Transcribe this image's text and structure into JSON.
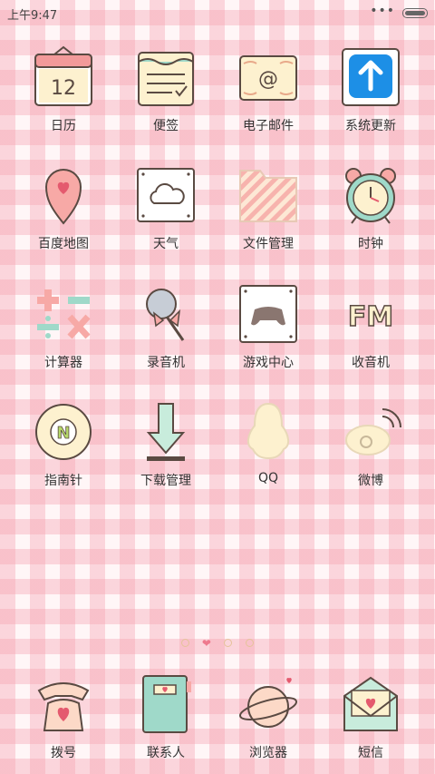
{
  "status_bar": {
    "time": "上午9:47",
    "signal_dots": "•••"
  },
  "apps": [
    {
      "label": "日历",
      "icon": "calendar-icon",
      "date_text": "12"
    },
    {
      "label": "便签",
      "icon": "notes-icon"
    },
    {
      "label": "电子邮件",
      "icon": "email-icon",
      "at_symbol": "@"
    },
    {
      "label": "系统更新",
      "icon": "update-arrow-icon"
    },
    {
      "label": "百度地图",
      "icon": "map-pin-icon"
    },
    {
      "label": "天气",
      "icon": "cloud-icon"
    },
    {
      "label": "文件管理",
      "icon": "folder-icon"
    },
    {
      "label": "时钟",
      "icon": "alarm-clock-icon"
    },
    {
      "label": "计算器",
      "icon": "calculator-icon"
    },
    {
      "label": "录音机",
      "icon": "microphone-icon"
    },
    {
      "label": "游戏中心",
      "icon": "gamepad-icon"
    },
    {
      "label": "收音机",
      "icon": "fm-radio-icon",
      "fm_text": "FM"
    },
    {
      "label": "指南针",
      "icon": "compass-icon",
      "compass_letter": "N"
    },
    {
      "label": "下载管理",
      "icon": "download-arrow-icon"
    },
    {
      "label": "QQ",
      "icon": "qq-penguin-icon"
    },
    {
      "label": "微博",
      "icon": "weibo-icon"
    }
  ],
  "dock": [
    {
      "label": "拨号",
      "icon": "telephone-icon"
    },
    {
      "label": "联系人",
      "icon": "contacts-book-icon"
    },
    {
      "label": "浏览器",
      "icon": "planet-browser-icon"
    },
    {
      "label": "短信",
      "icon": "envelope-icon"
    }
  ],
  "page_indicator": {
    "count": 4,
    "current_index": 1
  },
  "colors": {
    "gingham": "#f5a0af",
    "background": "#fff6f7",
    "label": "#333333",
    "accent_pink": "#ee7a8e"
  }
}
